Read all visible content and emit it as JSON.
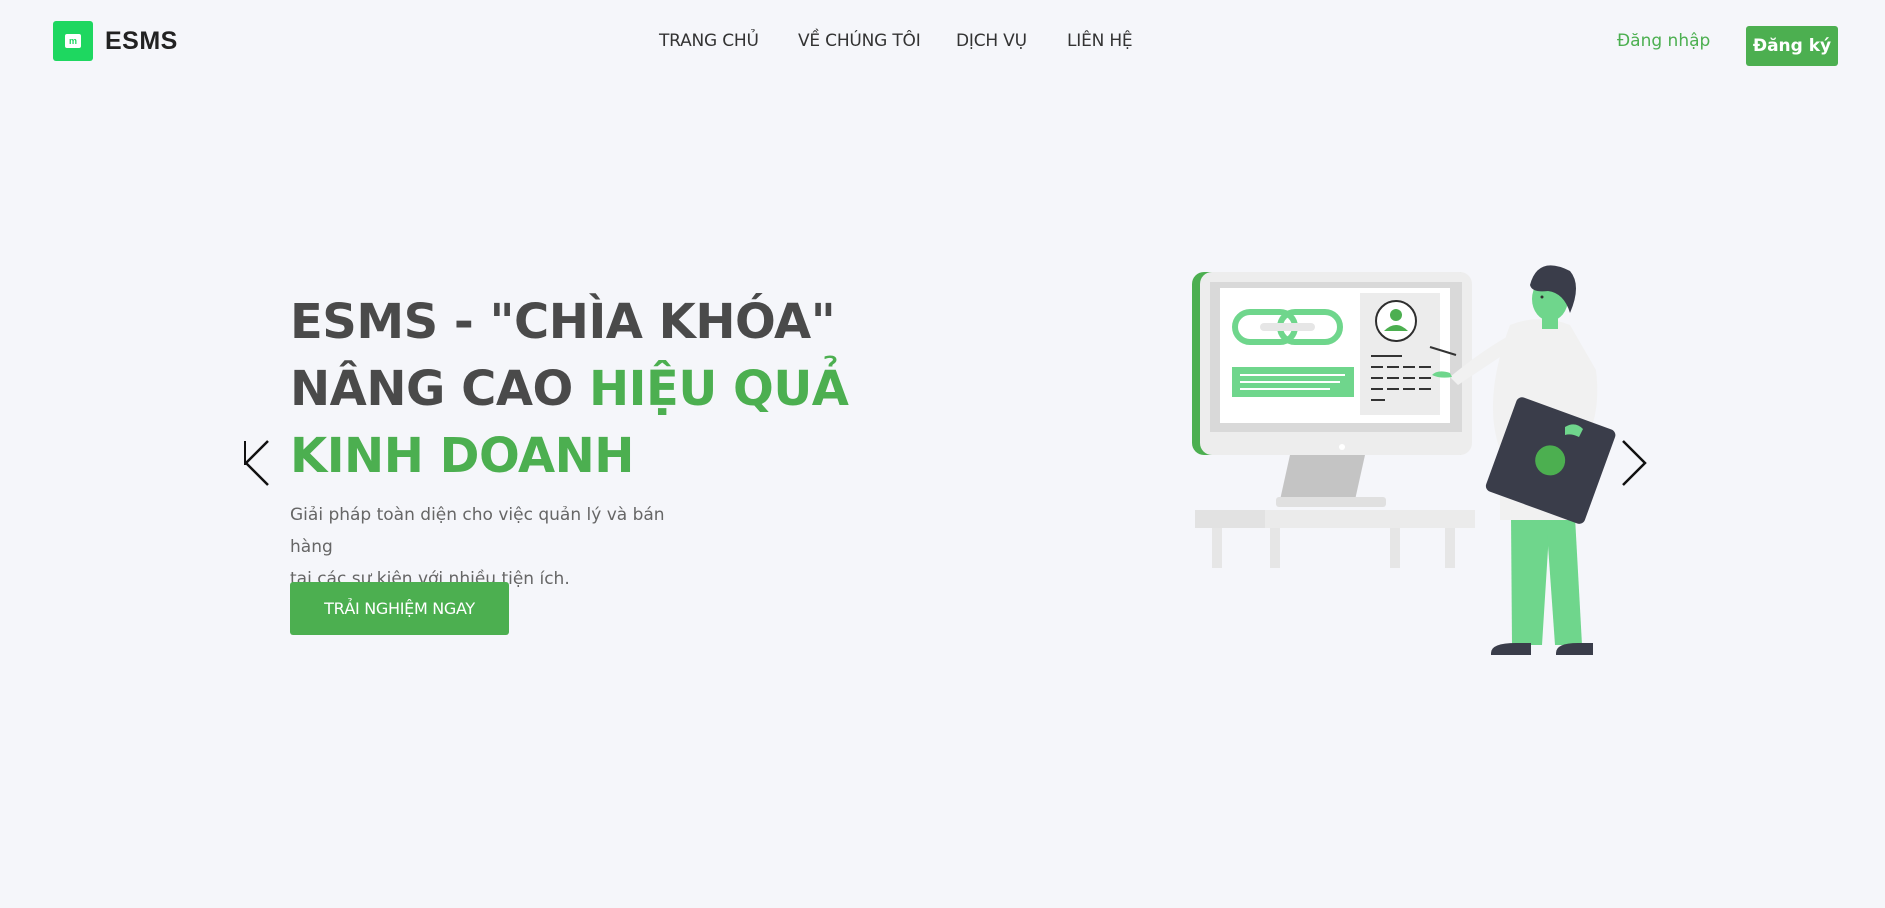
{
  "brand": {
    "name": "ESMS",
    "logo_glyph": "m",
    "logo_color": "#1ed760"
  },
  "nav": {
    "items": [
      {
        "label": "TRANG CHỦ"
      },
      {
        "label": "VỀ CHÚNG TÔI"
      },
      {
        "label": "DỊCH VỤ"
      },
      {
        "label": "LIÊN HỆ"
      }
    ],
    "login_label": "Đăng nhập",
    "signup_label": "Đăng ký"
  },
  "hero": {
    "title_line1": "ESMS - \"CHÌA KHÓA\"",
    "title_line2_plain": "NÂNG CAO ",
    "title_line2_accent": "HIỆU QUẢ",
    "title_line3_accent": "KINH DOANH",
    "subtitle_line1": "Giải pháp toàn diện cho việc quản lý và bán hàng",
    "subtitle_line2": "tại các sự kiện với nhiều tiện ích.",
    "cta_label": "TRẢI NGHIỆM NGAY"
  },
  "carousel": {
    "prev_icon": "chevron-left-icon",
    "next_icon": "chevron-right-icon"
  },
  "colors": {
    "accent": "#4caf50",
    "background": "#f5f6fa",
    "text_dark": "#4a4a4a"
  }
}
